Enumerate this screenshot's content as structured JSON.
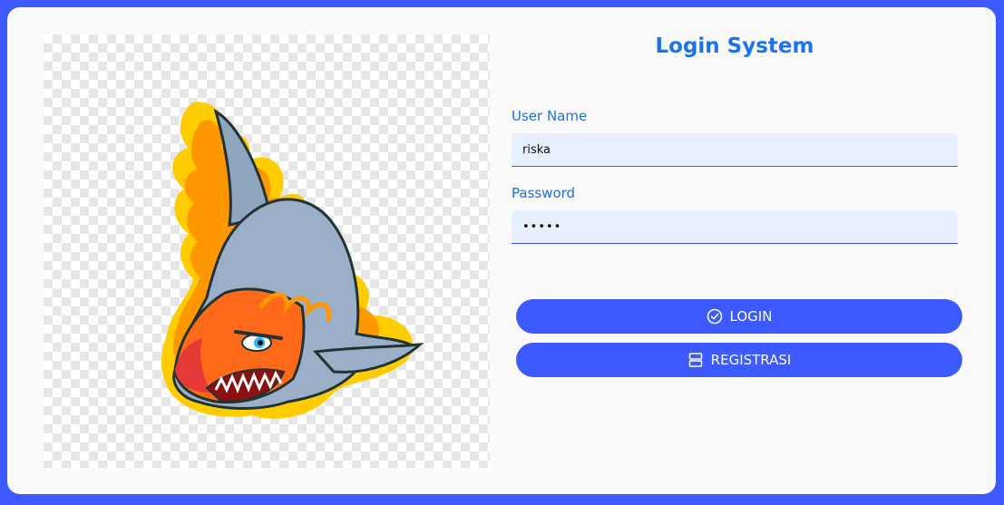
{
  "login": {
    "title": "Login System",
    "username_label": "User Name",
    "username_value": "riska",
    "password_label": "Password",
    "password_value": "•••••",
    "login_button": "LOGIN",
    "register_button": "REGISTRASI"
  },
  "icons": {
    "login": "check-circle-icon",
    "register": "server-icon"
  },
  "colors": {
    "background": "#3d5afe",
    "card": "#fafafa",
    "accent": "#3d5afe",
    "title": "#1a73e8",
    "field_bg": "#e8f0fe"
  }
}
